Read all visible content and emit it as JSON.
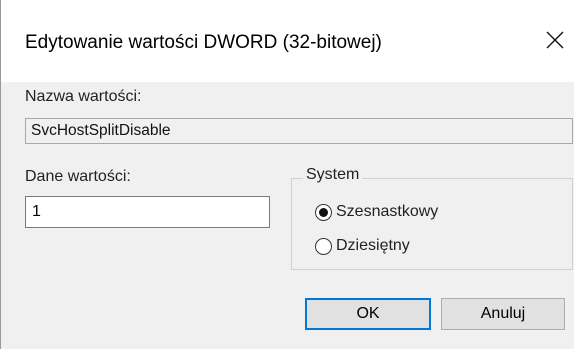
{
  "window": {
    "title": "Edytowanie wartości DWORD (32-bitowej)",
    "close_glyph": "✕",
    "close_icon": "close-icon"
  },
  "value_name": {
    "label": "Nazwa wartości:",
    "value": "SvcHostSplitDisable"
  },
  "value_data": {
    "label": "Dane wartości:",
    "value": "1"
  },
  "base": {
    "legend": "System",
    "options": [
      {
        "label": "Szesnastkowy",
        "selected": true
      },
      {
        "label": "Dziesiętny",
        "selected": false
      }
    ]
  },
  "buttons": {
    "ok": "OK",
    "cancel": "Anuluj"
  },
  "colors": {
    "accent": "#0078d7",
    "titlebar": "#ffffff",
    "dialog_bg": "#f0f0f0"
  }
}
